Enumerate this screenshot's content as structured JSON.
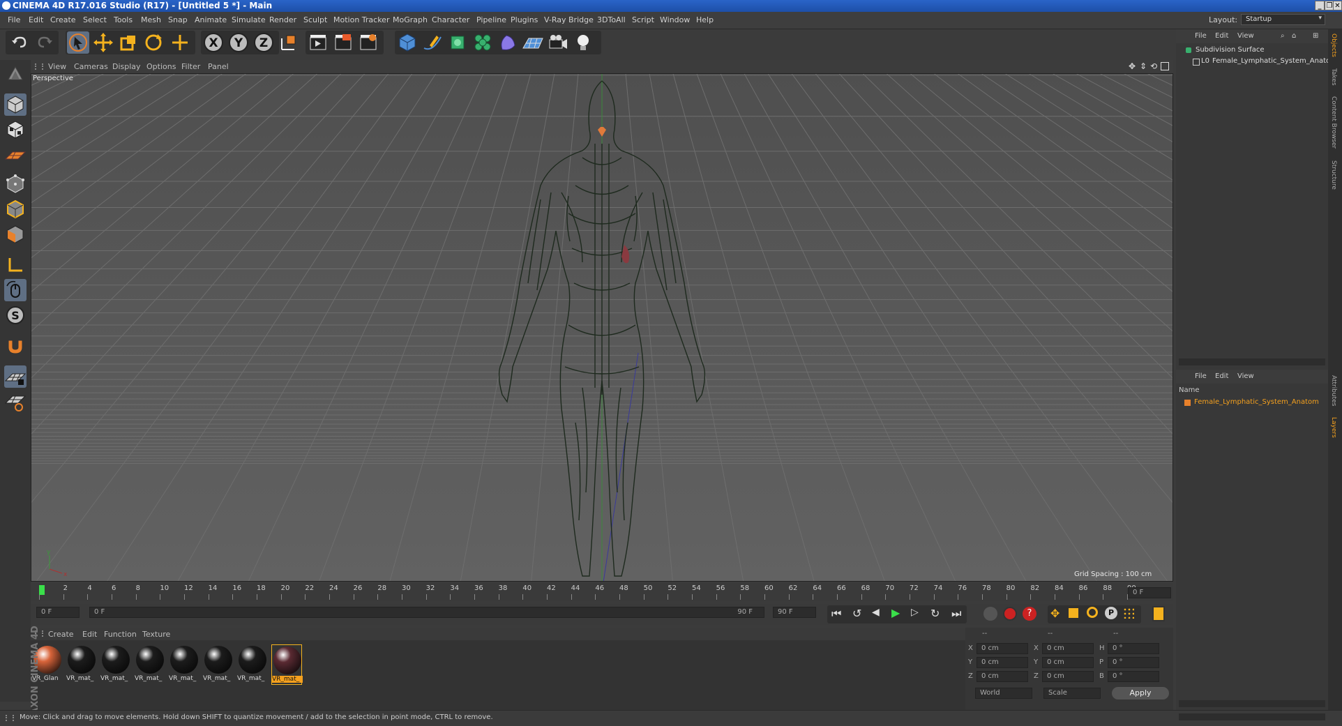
{
  "window": {
    "title": "CINEMA 4D R17.016 Studio (R17) - [Untitled 5 *] - Main",
    "controls": [
      "_",
      "❐",
      "✕"
    ]
  },
  "menu": {
    "items": [
      "File",
      "Edit",
      "Create",
      "Select",
      "Tools",
      "Mesh",
      "Snap",
      "Animate",
      "Simulate",
      "Render",
      "Sculpt",
      "Motion Tracker",
      "MoGraph",
      "Character",
      "Pipeline",
      "Plugins",
      "V-Ray Bridge",
      "3DToAll",
      "Script",
      "Window",
      "Help"
    ],
    "layout_label": "Layout:",
    "layout_value": "Startup"
  },
  "toolbar": {
    "icons": [
      "undo-icon",
      "redo-icon",
      "select-arrow-icon",
      "move-icon",
      "scale-icon",
      "rotate-icon",
      "last-tool-icon",
      "x-axis-icon",
      "y-axis-icon",
      "z-axis-icon",
      "world-coords-icon",
      "render-view-icon",
      "render-picture-viewer-icon",
      "render-settings-icon",
      "cube-primitive-icon",
      "pen-spline-icon",
      "subdivision-icon",
      "cloner-icon",
      "deformer-icon",
      "floor-icon",
      "camera-icon",
      "light-icon"
    ],
    "axis_labels": [
      "X",
      "Y",
      "Z"
    ]
  },
  "left_toolbar": {
    "icons": [
      "model-mode-icon",
      "object-mode-icon",
      "texture-mode-icon",
      "workplane-icon",
      "points-mode-icon",
      "edges-mode-icon",
      "polygons-mode-icon",
      "axis-mode-icon",
      "tweak-mode-icon",
      "solo-icon",
      "magnet-icon",
      "snap-grid-icon",
      "locked-workplane-icon"
    ],
    "solo_letter": "S"
  },
  "viewport": {
    "menu": [
      "View",
      "Cameras",
      "Display",
      "Options",
      "Filter",
      "Panel"
    ],
    "camera_label": "Perspective",
    "grid_spacing": "Grid Spacing : 100 cm",
    "axis_y": "y",
    "axis_x": "x"
  },
  "timeline": {
    "ticks": [
      "0",
      "2",
      "4",
      "6",
      "8",
      "10",
      "12",
      "14",
      "16",
      "18",
      "20",
      "22",
      "24",
      "26",
      "28",
      "30",
      "32",
      "34",
      "36",
      "38",
      "40",
      "42",
      "44",
      "46",
      "48",
      "50",
      "52",
      "54",
      "56",
      "58",
      "60",
      "62",
      "64",
      "66",
      "68",
      "70",
      "72",
      "74",
      "76",
      "78",
      "80",
      "82",
      "84",
      "86",
      "88",
      "90"
    ],
    "current_frame": "0 F",
    "start_frame": "0 F",
    "range_start": "0 F",
    "range_end": "90 F",
    "end_frame": "90 F"
  },
  "materials": {
    "menu": [
      "Create",
      "Edit",
      "Function",
      "Texture"
    ],
    "items": [
      {
        "label": "VR_Glan",
        "color": "#d8643a"
      },
      {
        "label": "VR_mat_",
        "color": "#1c1c1c"
      },
      {
        "label": "VR_mat_",
        "color": "#1c1c1c"
      },
      {
        "label": "VR_mat_",
        "color": "#1c1c1c"
      },
      {
        "label": "VR_mat_",
        "color": "#1c1c1c"
      },
      {
        "label": "VR_mat_",
        "color": "#1c1c1c"
      },
      {
        "label": "VR_mat_",
        "color": "#1c1c1c"
      },
      {
        "label": "VR_mat_",
        "color": "#5a2a32"
      }
    ]
  },
  "coordinates": {
    "headers": [
      "--",
      "--",
      "--"
    ],
    "rows": [
      {
        "a": "X",
        "a_val": "0 cm",
        "b": "X",
        "b_val": "0 cm",
        "c": "H",
        "c_val": "0 °"
      },
      {
        "a": "Y",
        "a_val": "0 cm",
        "b": "Y",
        "b_val": "0 cm",
        "c": "P",
        "c_val": "0 °"
      },
      {
        "a": "Z",
        "a_val": "0 cm",
        "b": "Z",
        "b_val": "0 cm",
        "c": "B",
        "c_val": "0 °"
      }
    ],
    "mode": "World",
    "scale_mode": "Scale",
    "apply": "Apply"
  },
  "objects_panel": {
    "menu": [
      "File",
      "Edit",
      "View"
    ],
    "tree": [
      "Subdivision Surface",
      "Female_Lymphatic_System_Anator"
    ]
  },
  "layers_panel": {
    "menu": [
      "File",
      "Edit",
      "View"
    ],
    "column": "Name",
    "items": [
      "Female_Lymphatic_System_Anatom"
    ]
  },
  "side_tabs": {
    "top": [
      "Objects",
      "Takes",
      "Content Browser",
      "Structure"
    ],
    "bottom": [
      "Attributes",
      "Layers"
    ]
  },
  "brand": "MAXON CINEMA 4D",
  "status": "Move: Click and drag to move elements. Hold down SHIFT to quantize movement / add to the selection in point mode, CTRL to remove."
}
